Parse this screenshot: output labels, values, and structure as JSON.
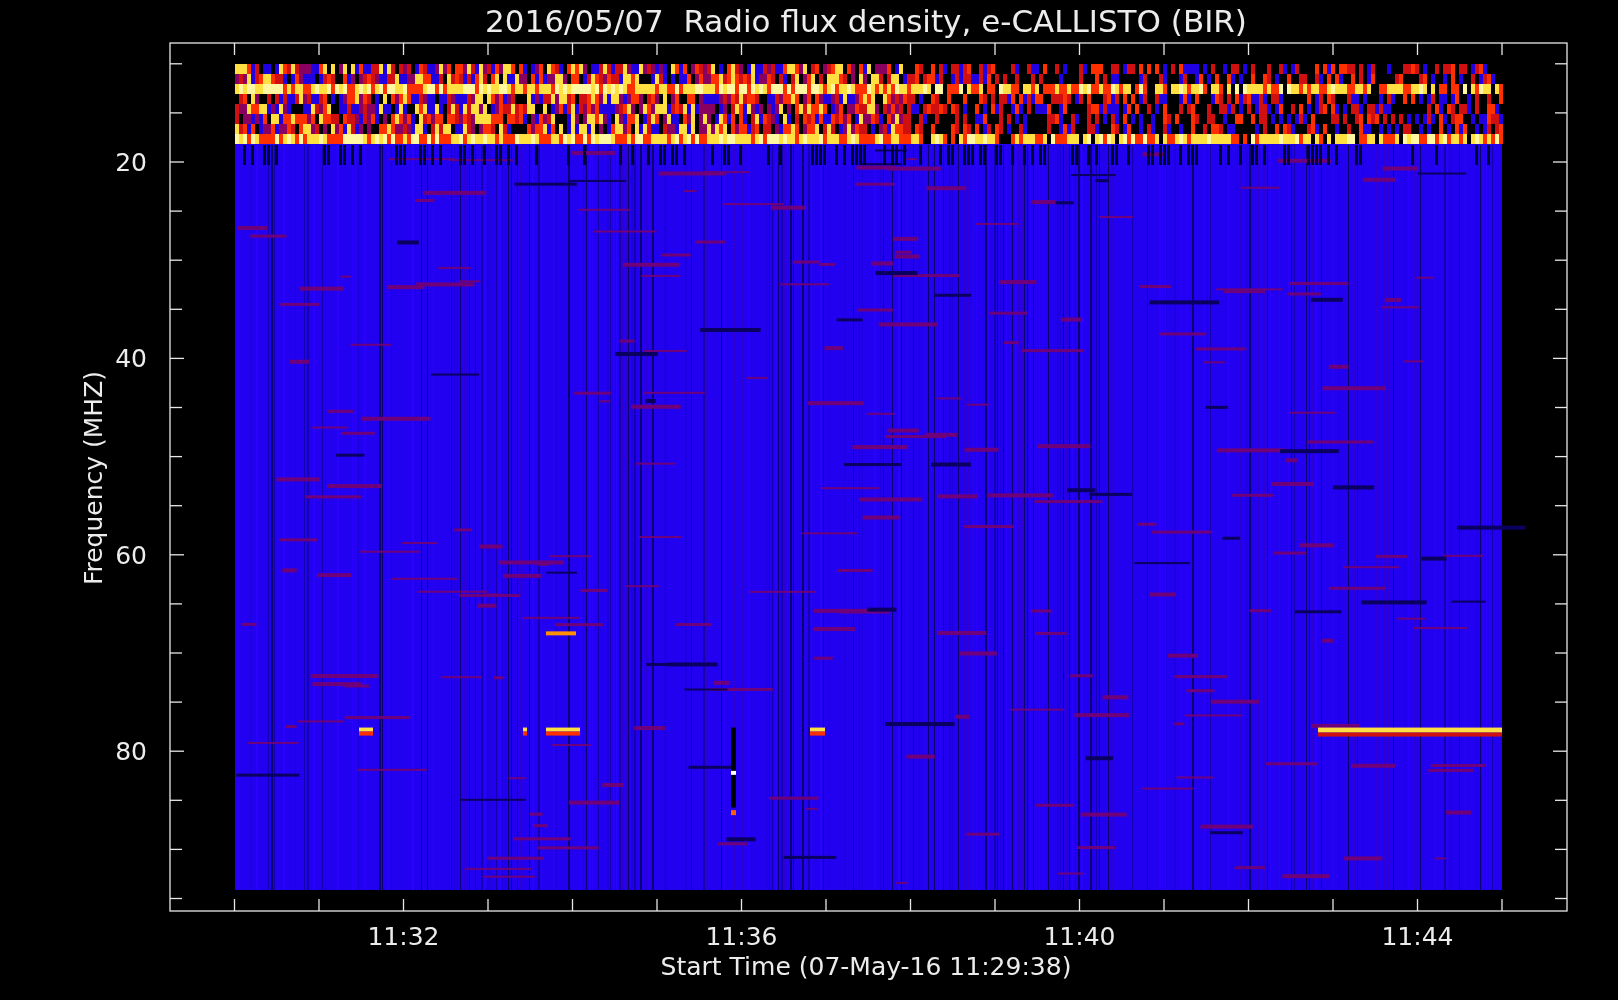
{
  "title": "2016/05/07  Radio flux density, e-CALLISTO (BIR)",
  "ylabel": "Frequency (MHZ)",
  "xlabel": "Start Time (07-May-16 11:29:38)",
  "yticks": [
    {
      "label": "20"
    },
    {
      "label": "40"
    },
    {
      "label": "60"
    },
    {
      "label": "80"
    }
  ],
  "xticks": [
    {
      "label": "11:32"
    },
    {
      "label": "11:36"
    },
    {
      "label": "11:40"
    },
    {
      "label": "11:44"
    }
  ]
}
